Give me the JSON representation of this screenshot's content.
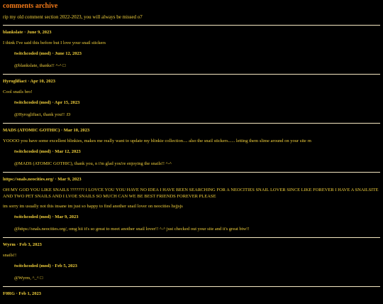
{
  "page": {
    "title": "comments archive",
    "subtitle": "rip my old comment section 2022-2023, you will always be missed o7"
  },
  "comments": [
    {
      "author": "blankslate",
      "date": "June 9, 2023",
      "text": "I think I've said this before but I love your snail stickers",
      "reply": {
        "author": "twitchcoded (mod)",
        "date": "June 12, 2023",
        "text": "@blankslate, thanks!! ^-^ □"
      }
    },
    {
      "author": "Hyroglifiact",
      "date": "Apr 10, 2023",
      "text": "Cool snails bro!",
      "reply": {
        "author": "twitchcoded (mod)",
        "date": "Apr 15, 2023",
        "text": "@Hyroglifiact, thank you!! :D"
      }
    },
    {
      "author": "MADS (ATOMIC GOTHIC)",
      "date": "Mar 10, 2023",
      "text": "YOOOO you have some excellent blinkies, makes me really want to update my blinkie collection.... also the snail stickers...... letting them slime around on your site rn",
      "reply": {
        "author": "twitchcoded (mod)",
        "date": "Mar 12, 2023",
        "text": "@MADS (ATOMIC GOTHIC), thank you, n i'm glad you're enjoying the snails!! ^-^"
      }
    },
    {
      "author": "https://snals.neocities.org/",
      "date": "Mar 9, 2023",
      "text": "OH MY GOD YOU LIKE SNAILS ??????? I LOVCE YOU YOU HAVE NO IDEA I HAVE BEEN SEARCHING FOR A NEOCITIES SNAIL LOVER SINCE LIKE FOREVER I HAVE A SNAILSITE AND TWO PET SNAILS AND I LVOE SNAILS SO MUCH CAN WE BE BEST FRIENDS FOREVER PLEASE",
      "text2": "im sorry im usually not this insane im just so happy to find another snail lover on neocities hsjjsjs",
      "reply": {
        "author": "twitchcoded (mod)",
        "date": "Mar 9, 2023",
        "text": "@https://snals.neocities.org/, omg hii it's so great to meet another snail lover!! ^-^ just checked out your site and it's great btw!!"
      }
    },
    {
      "author": "Wyrm",
      "date": "Feb 3, 2023",
      "text": "snails!!",
      "reply": {
        "author": "twitchcoded (mod)",
        "date": "Feb 5, 2023",
        "text": "@Wyrm, ^_^ □"
      }
    },
    {
      "author": "F0RG",
      "date": "Feb 1, 2023"
    }
  ],
  "separator": " · ",
  "colors": {
    "background": "#000000",
    "text": "#f4d23c",
    "title": "#f07818",
    "rule": "#f4e7c2"
  }
}
